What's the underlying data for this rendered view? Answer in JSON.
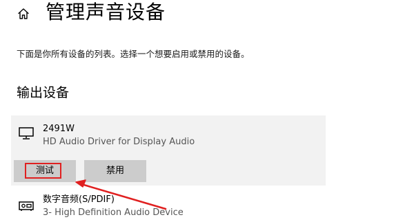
{
  "header": {
    "title": "管理声音设备"
  },
  "description": "下面是你所有设备的列表。选择一个想要启用或禁用的设备。",
  "output_section": {
    "heading": "输出设备",
    "devices": [
      {
        "name": "2491W",
        "driver": "HD Audio Driver for Display Audio",
        "icon": "monitor-icon",
        "buttons": {
          "test_label": "测试",
          "disable_label": "禁用"
        }
      },
      {
        "name": "数字音频(S/PDIF)",
        "driver": "3- High Definition Audio Device",
        "icon": "spdif-port-icon"
      }
    ]
  },
  "colors": {
    "annotation": "#e02020",
    "card_background": "#f2f2f2",
    "button_background": "#cccccc"
  }
}
